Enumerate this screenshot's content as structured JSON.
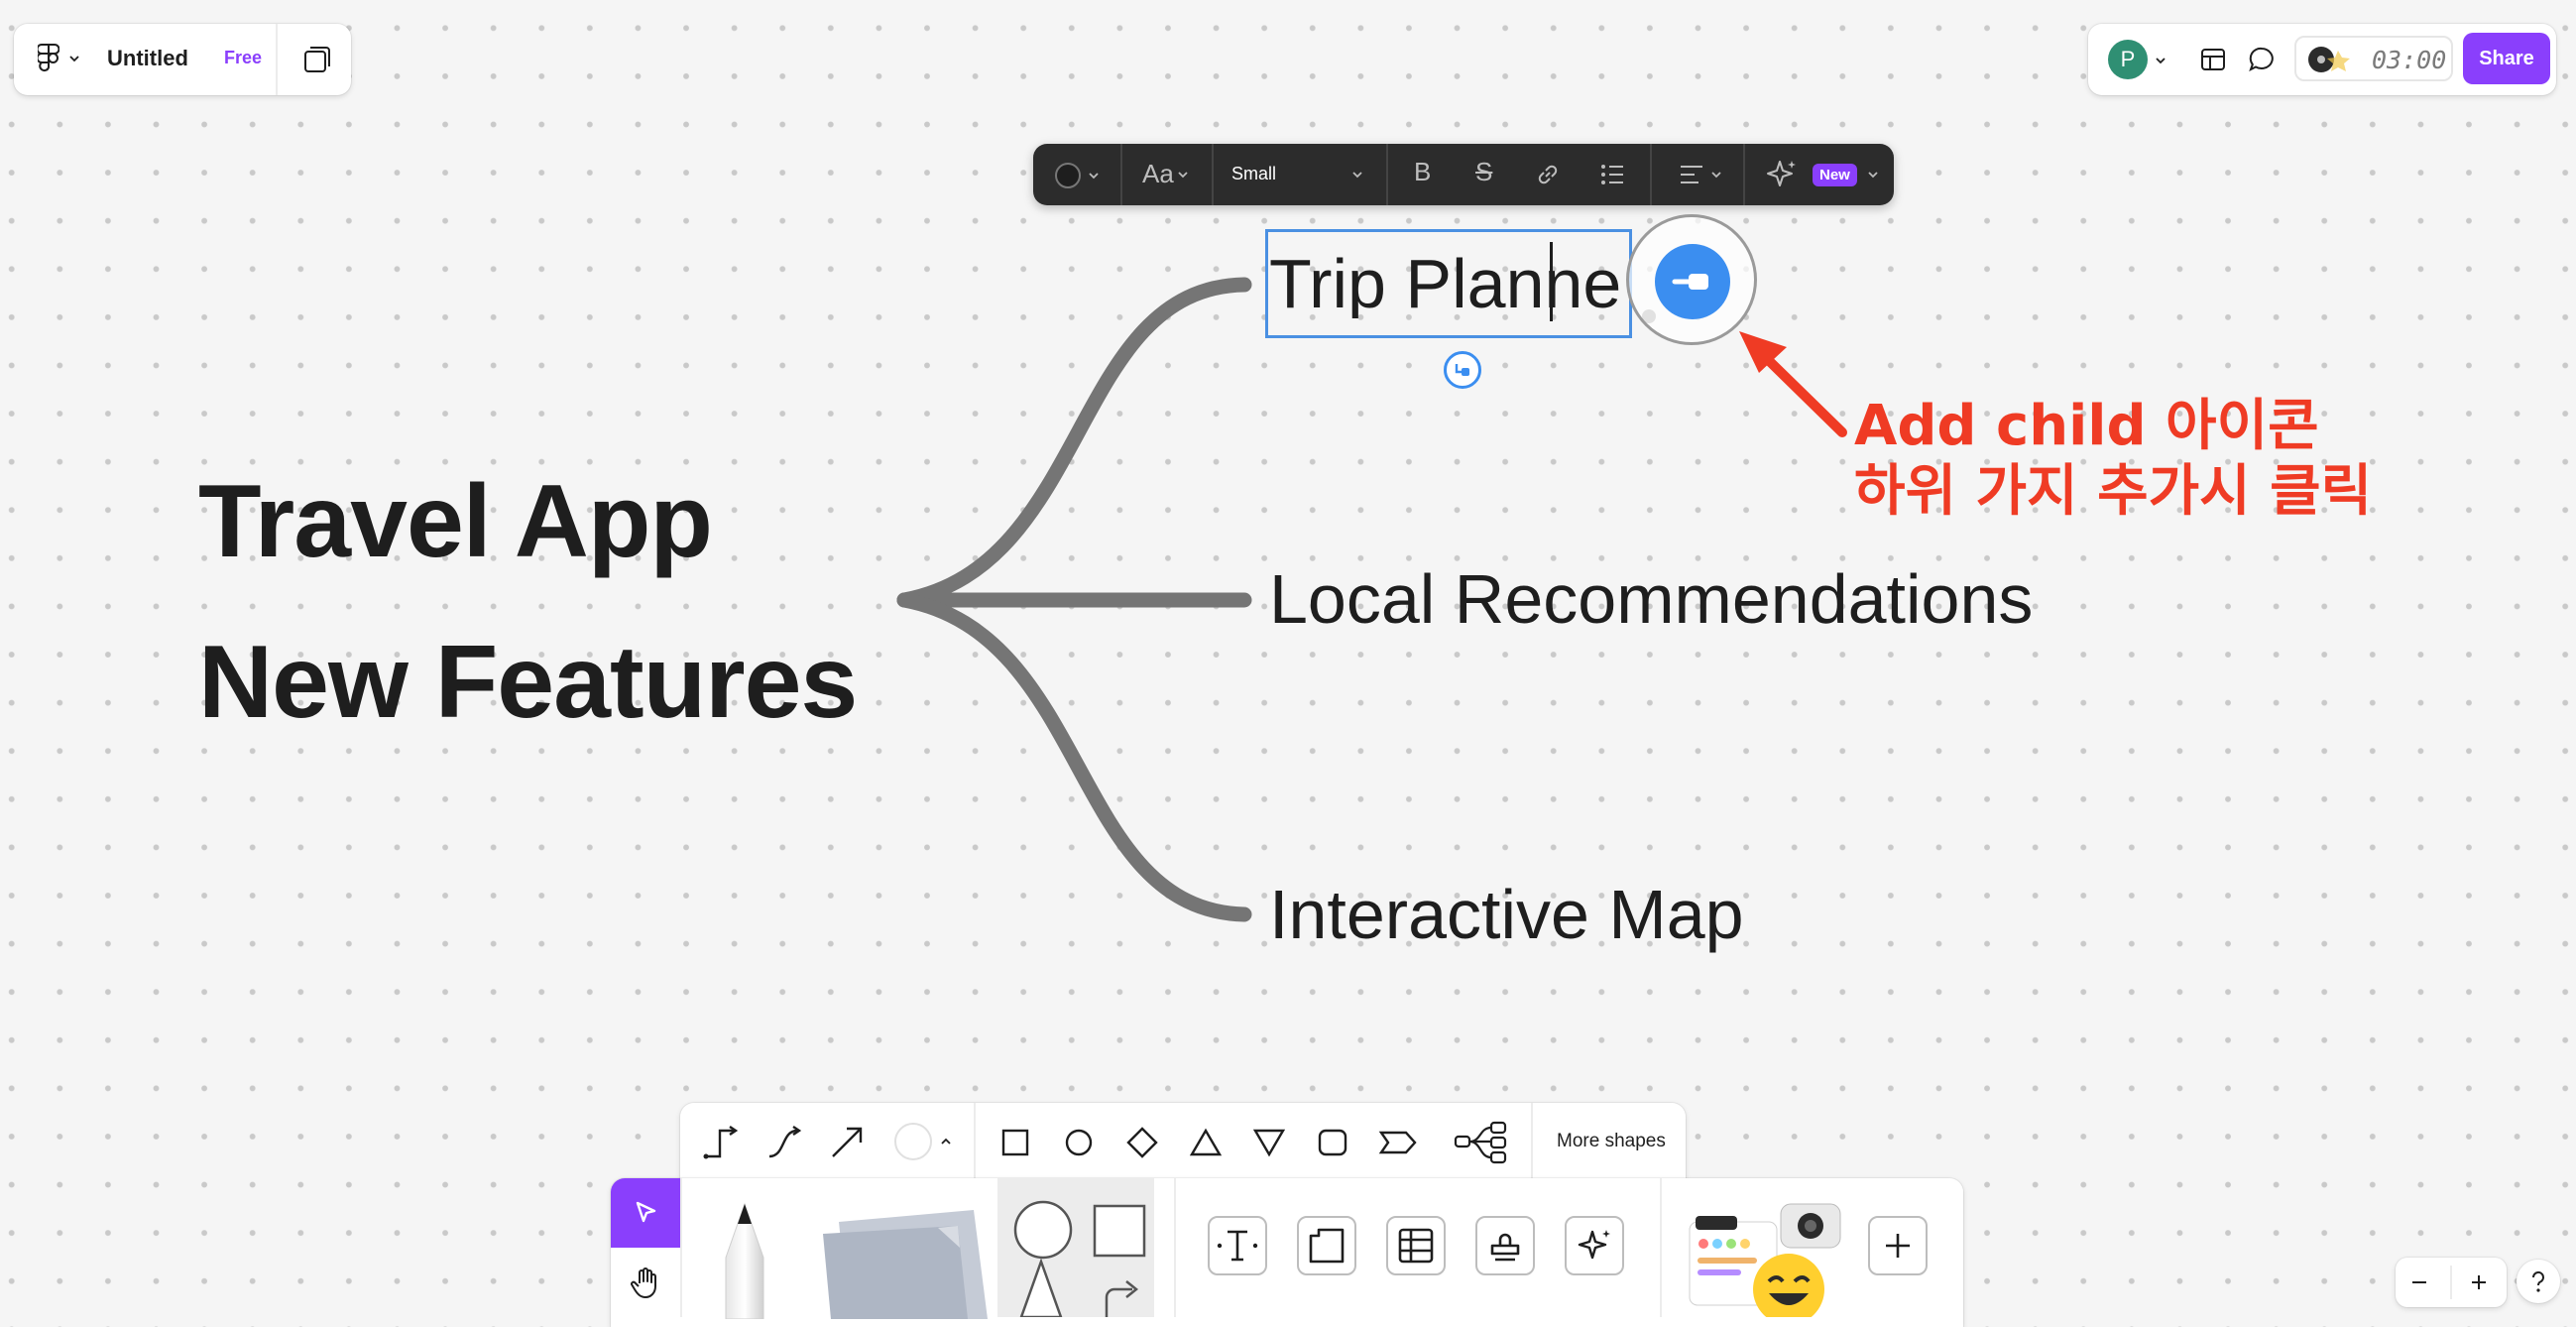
{
  "header": {
    "file_title": "Untitled",
    "plan_badge": "Free",
    "avatar_initial": "P",
    "timer": "03:00",
    "share_label": "Share"
  },
  "text_toolbar": {
    "font_size": "Small",
    "ai_badge": "New"
  },
  "mindmap": {
    "root_line1": "Travel App",
    "root_line2": "New Features",
    "children": [
      "Trip Planne",
      "Local Recommendations",
      "Interactive Map"
    ]
  },
  "annotation": {
    "line1": "Add child 아이콘",
    "line2": "하위 가지 추가시 클릭",
    "color": "#ef3b24"
  },
  "shapes_toolbar": {
    "more_label": "More shapes"
  },
  "colors": {
    "accent": "#8a3ffc",
    "selection": "#4a90e2",
    "connector": "#757575",
    "toolbar_dark": "#2c2c2c"
  }
}
